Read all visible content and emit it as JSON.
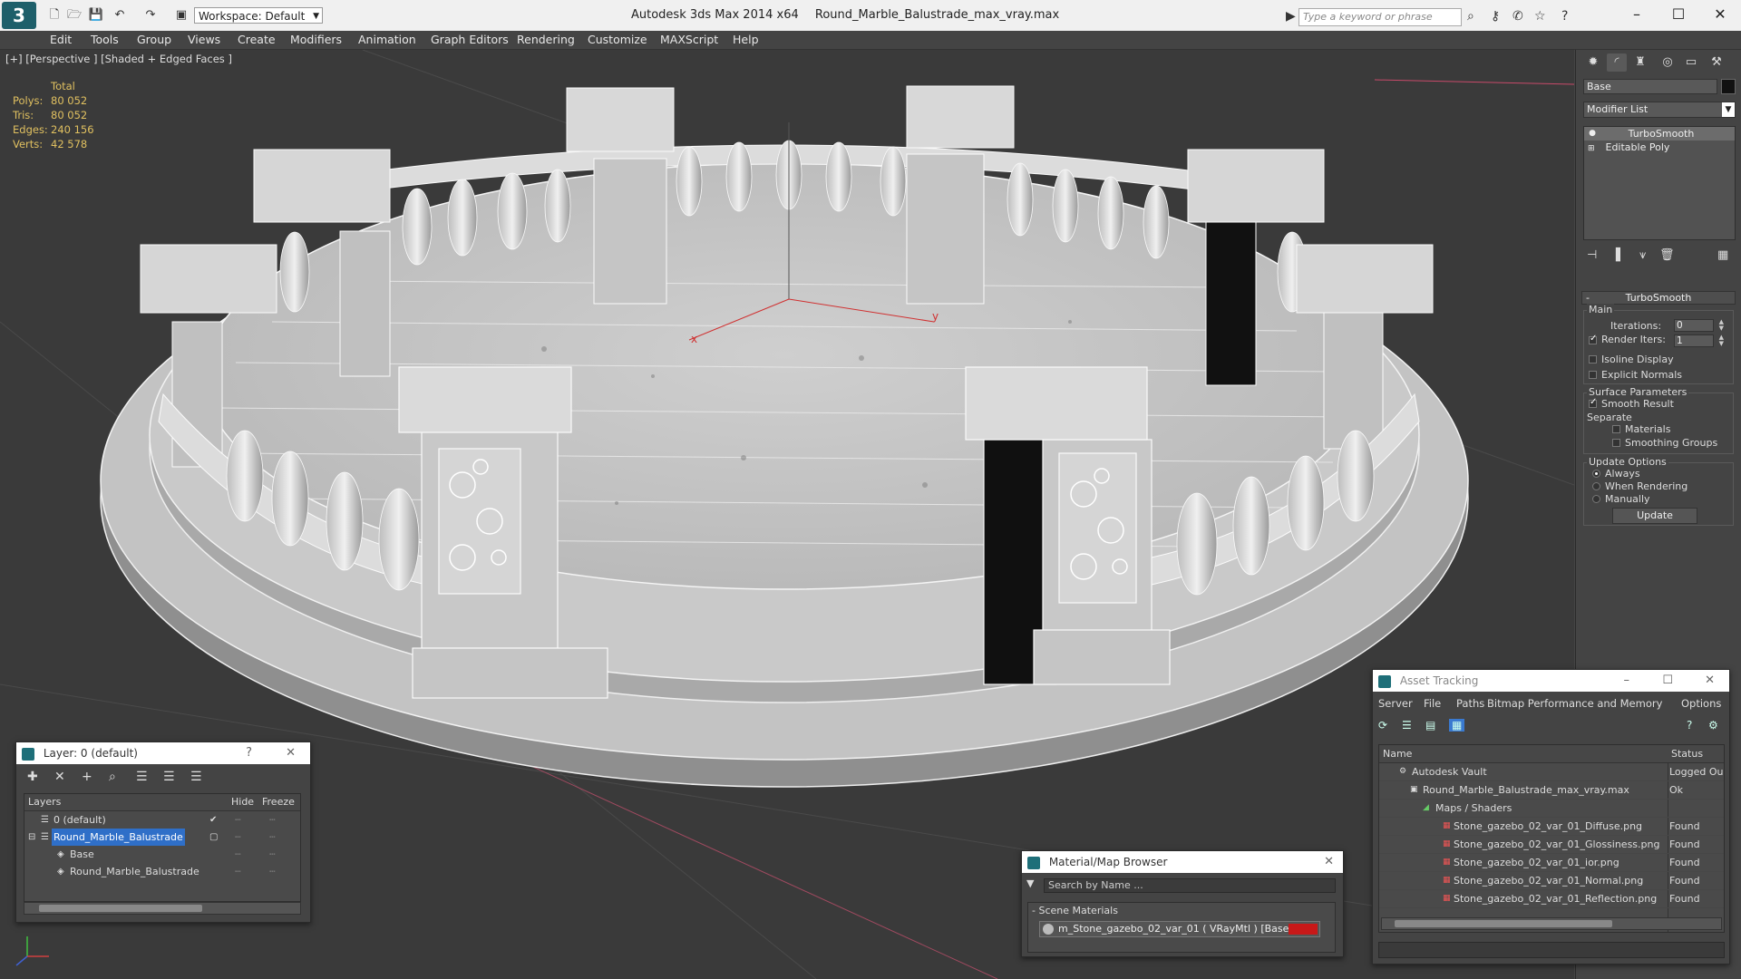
{
  "titlebar": {
    "app_logo": "3",
    "workspace": "Workspace: Default",
    "app_name": "Autodesk 3ds Max  2014 x64",
    "file_name": "Round_Marble_Balustrade_max_vray.max",
    "search_placeholder": "Type a keyword or phrase"
  },
  "menu": [
    "Edit",
    "Tools",
    "Group",
    "Views",
    "Create",
    "Modifiers",
    "Animation",
    "Graph Editors",
    "Rendering",
    "Customize",
    "MAXScript",
    "Help"
  ],
  "viewport": {
    "label": "[+] [Perspective ] [Shaded + Edged Faces ]",
    "stats": {
      "header": "Total",
      "rows": [
        {
          "k": "Polys:",
          "v": "80 052"
        },
        {
          "k": "Tris:",
          "v": "80 052"
        },
        {
          "k": "Edges:",
          "v": "240 156"
        },
        {
          "k": "Verts:",
          "v": "42 578"
        }
      ]
    },
    "axis_x": "x",
    "axis_y": "y"
  },
  "command_panel": {
    "object_name": "Base",
    "modifier_list": "Modifier List",
    "stack": [
      "TurboSmooth",
      "Editable Poly"
    ],
    "rollout": "TurboSmooth",
    "main_group": "Main",
    "iterations_label": "Iterations:",
    "iterations_value": "0",
    "render_iters_label": "Render Iters:",
    "render_iters_value": "1",
    "isoline": "Isoline Display",
    "explicit_normals": "Explicit Normals",
    "surface_group": "Surface Parameters",
    "smooth_result": "Smooth Result",
    "separate": "Separate",
    "materials": "Materials",
    "smoothing_groups": "Smoothing Groups",
    "update_group": "Update Options",
    "always": "Always",
    "when_rendering": "When Rendering",
    "manually": "Manually",
    "update_btn": "Update"
  },
  "layer_window": {
    "title": "Layer: 0 (default)",
    "help": "?",
    "close": "✕",
    "col_layers": "Layers",
    "col_hide": "Hide",
    "col_freeze": "Freeze",
    "rows": [
      "0 (default)",
      "Round_Marble_Balustrade",
      "Base",
      "Round_Marble_Balustrade"
    ]
  },
  "material_window": {
    "title": "Material/Map Browser",
    "close": "✕",
    "search": "Search by Name ...",
    "section": "Scene Materials",
    "item": "m_Stone_gazebo_02_var_01  ( VRayMtl )  [Base]"
  },
  "asset_window": {
    "title": "Asset Tracking",
    "menu": [
      "Server",
      "File",
      "Paths",
      "Bitmap Performance and Memory",
      "Options"
    ],
    "col_name": "Name",
    "col_status": "Status",
    "rows": [
      {
        "name": "Autodesk Vault",
        "status": "Logged Ou"
      },
      {
        "name": "Round_Marble_Balustrade_max_vray.max",
        "status": "Ok"
      },
      {
        "name": "Maps / Shaders",
        "status": ""
      },
      {
        "name": "Stone_gazebo_02_var_01_Diffuse.png",
        "status": "Found"
      },
      {
        "name": "Stone_gazebo_02_var_01_Glossiness.png",
        "status": "Found"
      },
      {
        "name": "Stone_gazebo_02_var_01_ior.png",
        "status": "Found"
      },
      {
        "name": "Stone_gazebo_02_var_01_Normal.png",
        "status": "Found"
      },
      {
        "name": "Stone_gazebo_02_var_01_Reflection.png",
        "status": "Found"
      }
    ]
  },
  "colors": {
    "viewport_bg": "#3a3a3a",
    "stats_text": "#e0c060",
    "selection": "#2f6fc8",
    "material_swatch": "#c81818"
  }
}
